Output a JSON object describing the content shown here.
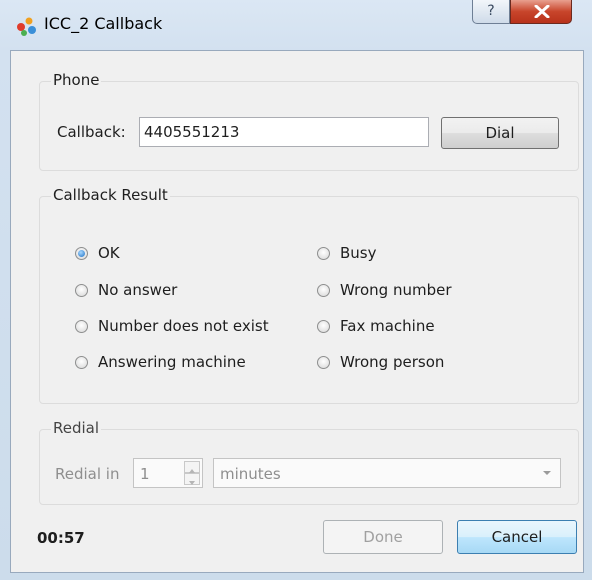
{
  "window": {
    "title": "ICC_2 Callback",
    "help_label": "?",
    "close_label": "X"
  },
  "phone": {
    "group_title": "Phone",
    "callback_label": "Callback:",
    "callback_value": "4405551213",
    "dial_label": "Dial"
  },
  "result": {
    "group_title": "Callback Result",
    "options": [
      {
        "label": "OK",
        "checked": true
      },
      {
        "label": "Busy",
        "checked": false
      },
      {
        "label": "No answer",
        "checked": false
      },
      {
        "label": "Wrong number",
        "checked": false
      },
      {
        "label": "Number does not exist",
        "checked": false
      },
      {
        "label": "Fax machine",
        "checked": false
      },
      {
        "label": "Answering machine",
        "checked": false
      },
      {
        "label": "Wrong person",
        "checked": false
      }
    ]
  },
  "redial": {
    "group_title": "Redial",
    "redial_in_label": "Redial in",
    "count_value": "1",
    "unit_value": "minutes",
    "enabled": false
  },
  "footer": {
    "timer": "00:57",
    "done_label": "Done",
    "cancel_label": "Cancel"
  }
}
